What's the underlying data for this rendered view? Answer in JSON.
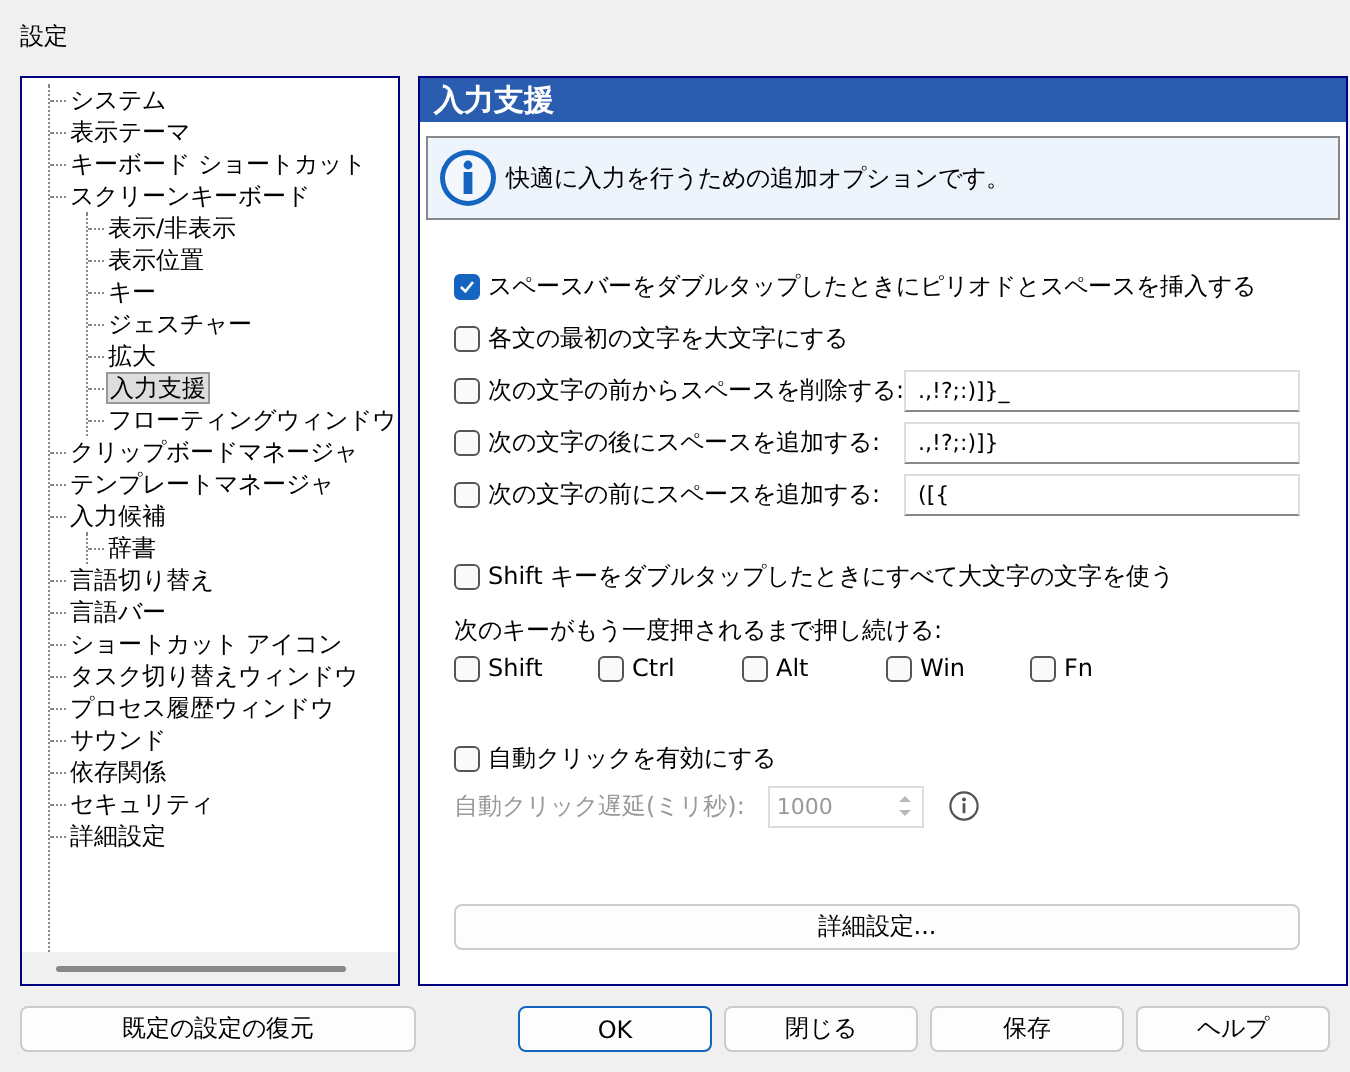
{
  "window": {
    "title": "設定"
  },
  "tree": [
    {
      "label": "システム",
      "selected": false
    },
    {
      "label": "表示テーマ",
      "selected": false
    },
    {
      "label": "キーボード ショートカット",
      "selected": false
    },
    {
      "label": "スクリーンキーボード",
      "selected": false,
      "children": [
        {
          "label": "表示/非表示",
          "selected": false
        },
        {
          "label": "表示位置",
          "selected": false
        },
        {
          "label": "キー",
          "selected": false
        },
        {
          "label": "ジェスチャー",
          "selected": false
        },
        {
          "label": "拡大",
          "selected": false
        },
        {
          "label": "入力支援",
          "selected": true
        },
        {
          "label": "フローティングウィンドウ",
          "selected": false
        }
      ]
    },
    {
      "label": "クリップボードマネージャ",
      "selected": false
    },
    {
      "label": "テンプレートマネージャ",
      "selected": false
    },
    {
      "label": "入力候補",
      "selected": false,
      "children": [
        {
          "label": "辞書",
          "selected": false
        }
      ]
    },
    {
      "label": "言語切り替え",
      "selected": false
    },
    {
      "label": "言語バー",
      "selected": false
    },
    {
      "label": "ショートカット アイコン",
      "selected": false
    },
    {
      "label": "タスク切り替えウィンドウ",
      "selected": false
    },
    {
      "label": "プロセス履歴ウィンドウ",
      "selected": false
    },
    {
      "label": "サウンド",
      "selected": false
    },
    {
      "label": "依存関係",
      "selected": false
    },
    {
      "label": "セキュリティ",
      "selected": false
    },
    {
      "label": "詳細設定",
      "selected": false
    }
  ],
  "panel": {
    "title": "入力支援",
    "info": "快適に入力を行うための追加オプションです。",
    "options": [
      {
        "kind": "check",
        "label": "スペースバーをダブルタップしたときにピリオドとスペースを挿入する",
        "checked": true
      },
      {
        "kind": "check",
        "label": "各文の最初の文字を大文字にする",
        "checked": false
      },
      {
        "kind": "check_field",
        "label": "次の文字の前からスペースを削除する:",
        "checked": false,
        "value": ".,!?;:)]}_"
      },
      {
        "kind": "check_field",
        "label": "次の文字の後にスペースを追加する:",
        "checked": false,
        "value": ".,!?;:)]}"
      },
      {
        "kind": "check_field",
        "label": "次の文字の前にスペースを追加する:",
        "checked": false,
        "value": "([{"
      }
    ],
    "shift_option": {
      "label": "Shift キーをダブルタップしたときにすべて大文字の文字を使う",
      "checked": false
    },
    "sticky_label": "次のキーがもう一度押されるまで押し続ける:",
    "sticky_keys": [
      {
        "label": "Shift",
        "checked": false
      },
      {
        "label": "Ctrl",
        "checked": false
      },
      {
        "label": "Alt",
        "checked": false
      },
      {
        "label": "Win",
        "checked": false
      },
      {
        "label": "Fn",
        "checked": false
      }
    ],
    "autoclick": {
      "label": "自動クリックを有効にする",
      "checked": false
    },
    "delay": {
      "label": "自動クリック遅延(ミリ秒):",
      "value": "1000",
      "disabled": true
    },
    "advanced_button": "詳細設定..."
  },
  "buttons": [
    {
      "label": "既定の設定の復元",
      "default": false
    },
    {
      "label": "OK",
      "default": true
    },
    {
      "label": "閉じる",
      "default": false
    },
    {
      "label": "保存",
      "default": false
    },
    {
      "label": "ヘルプ",
      "default": false
    }
  ]
}
